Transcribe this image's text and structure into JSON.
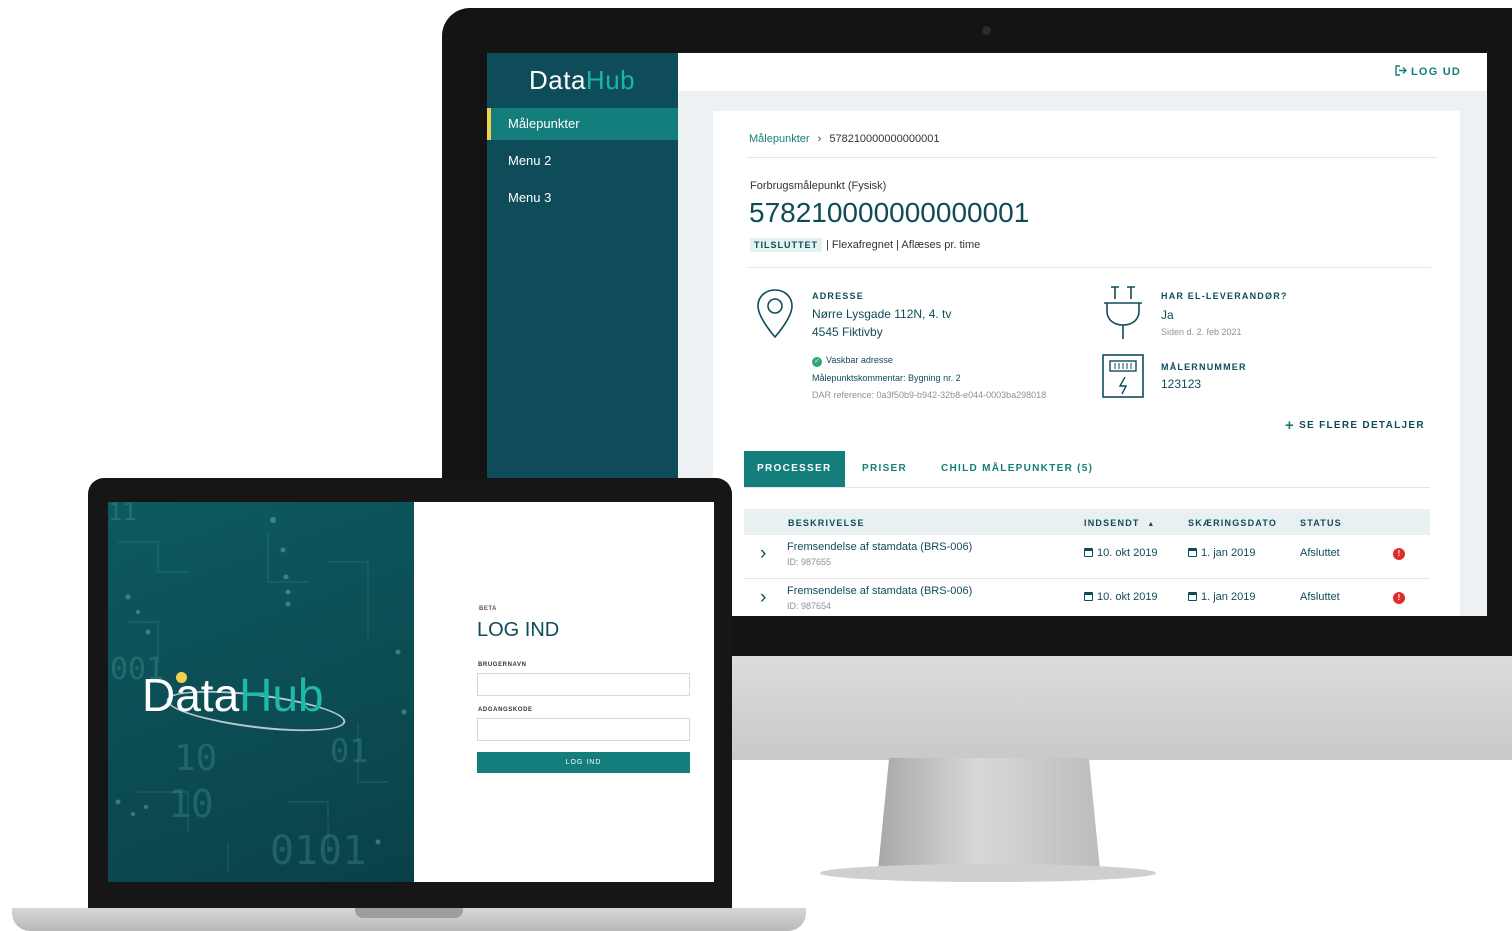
{
  "app": {
    "logo_data": "Data",
    "logo_hub": "Hub"
  },
  "sidebar": {
    "items": [
      {
        "label": "Målepunkter"
      },
      {
        "label": "Menu 2"
      },
      {
        "label": "Menu 3"
      }
    ]
  },
  "topbar": {
    "logout_label": "LOG UD"
  },
  "breadcrumb": {
    "root": "Målepunkter",
    "current": "578210000000000001"
  },
  "meteringpoint": {
    "type": "Forbrugsmålepunkt (Fysisk)",
    "id": "578210000000000001",
    "status_badge": "TILSLUTTET",
    "tags_text": "| Flexafregnet | Aflæses pr. time"
  },
  "address": {
    "label": "ADRESSE",
    "line1": "Nørre Lysgade 112N, 4. tv",
    "line2": "4545 Fiktivby",
    "wash": "Vaskbar adresse",
    "comment": "Målepunktskommentar: Bygning nr. 2",
    "dar": "DAR reference: 0a3f50b9-b942-32b8-e044-0003ba298018"
  },
  "supplier": {
    "label": "HAR EL-LEVERANDØR?",
    "value": "Ja",
    "since": "Siden d. 2. feb 2021"
  },
  "meter": {
    "label": "MÅLERNUMMER",
    "value": "123123"
  },
  "details_link": "SE FLERE DETALJER",
  "tabs": [
    {
      "label": "PROCESSER"
    },
    {
      "label": "PRISER"
    },
    {
      "label": "CHILD MÅLEPUNKTER (5)"
    }
  ],
  "table": {
    "headers": [
      "BESKRIVELSE",
      "INDSENDT",
      "SKÆRINGSDATO",
      "STATUS"
    ],
    "sort_indicator": "▲",
    "rows": [
      {
        "description": "Fremsendelse af stamdata (BRS-006)",
        "id": "ID: 987655",
        "submitted": "10. okt 2019",
        "cutoff": "1. jan 2019",
        "status": "Afsluttet"
      },
      {
        "description": "Fremsendelse af stamdata (BRS-006)",
        "id": "ID: 987654",
        "submitted": "10. okt 2019",
        "cutoff": "1. jan 2019",
        "status": "Afsluttet"
      }
    ]
  },
  "login": {
    "beta": "BETA",
    "title": "LOG IND",
    "username_label": "BRUGERNAVN",
    "password_label": "ADGANGSKODE",
    "button": "LOG IND"
  },
  "art_digits": [
    "11",
    "001",
    "10",
    "10",
    "01",
    "0101"
  ],
  "colors": {
    "primary": "#0f4c5a",
    "accent": "#147e7d",
    "highlight": "#f0d34b",
    "error": "#e02b2b"
  }
}
